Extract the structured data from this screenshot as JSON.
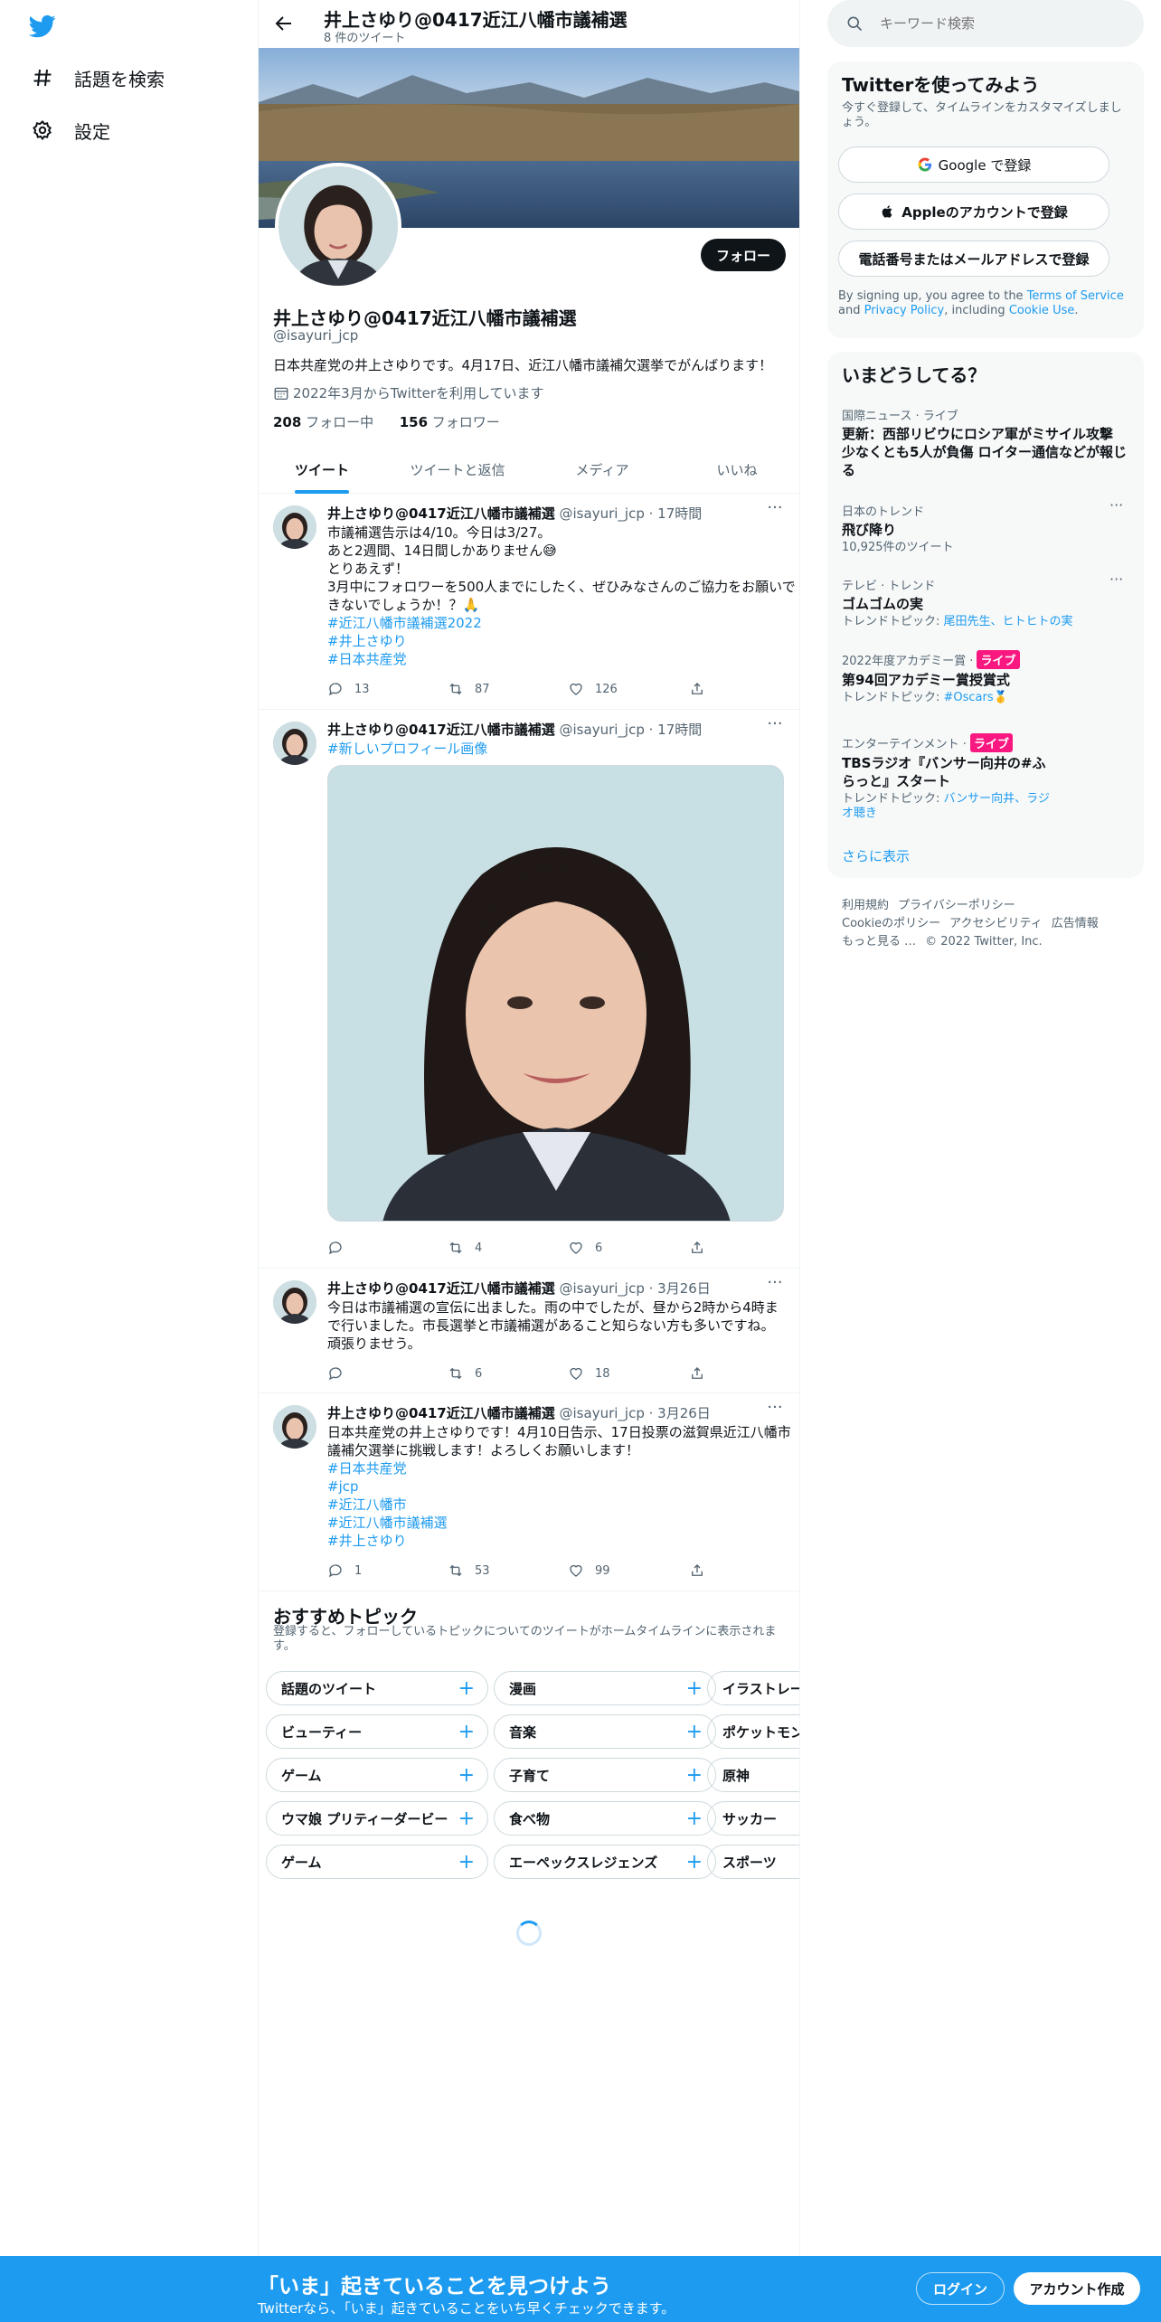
{
  "nav": {
    "items": [
      {
        "label": "話題を検索",
        "icon": "hashtag-icon"
      },
      {
        "label": "設定",
        "icon": "gear-icon"
      }
    ]
  },
  "header": {
    "title": "井上さゆり@0417近江八幡市議補選",
    "subtitle": "8 件のツイート"
  },
  "profile": {
    "name": "井上さゆり@0417近江八幡市議補選",
    "handle": "@isayuri_jcp",
    "bio": "日本共産党の井上さゆりです。4月17日、近江八幡市議補欠選挙でがんばります！",
    "joined": "2022年3月からTwitterを利用しています",
    "following_count": "208",
    "following_label": " フォロー中",
    "followers_count": "156",
    "followers_label": " フォロワー",
    "follow_button": "フォロー"
  },
  "tabs": [
    "ツイート",
    "ツイートと返信",
    "メディア",
    "いいね"
  ],
  "tweets": [
    {
      "name": "井上さゆり@0417近江八幡市議補選",
      "meta": " @isayuri_jcp · 17時間",
      "lines": [
        "市議補選告示は4/10。今日は3/27。",
        "あと2週間、14日間しかありません😅",
        "とりあえず！",
        "3月中にフォロワーを500人までにしたく、ぜひみなさんのご協力をお願いで",
        "きないでしょうか！？🙏"
      ],
      "tags": [
        "#近江八幡市議補選2022",
        "#井上さゆり",
        "#日本共産党"
      ],
      "replies": "13",
      "retweets": "87",
      "likes": "126"
    },
    {
      "name": "井上さゆり@0417近江八幡市議補選",
      "meta": " @isayuri_jcp · 17時間",
      "lines": [],
      "tags": [
        "#新しいプロフィール画像"
      ],
      "replies": "",
      "retweets": "4",
      "likes": "6"
    },
    {
      "name": "井上さゆり@0417近江八幡市議補選",
      "meta": " @isayuri_jcp · 3月26日",
      "lines": [
        "今日は市議補選の宣伝に出ました。雨の中でしたが、昼から2時から4時ま",
        "で行いました。市長選挙と市議補選があること知らない方も多いですね。",
        "頑張りませう。"
      ],
      "tags": [],
      "replies": "",
      "retweets": "6",
      "likes": "18"
    },
    {
      "name": "井上さゆり@0417近江八幡市議補選",
      "meta": " @isayuri_jcp · 3月26日",
      "lines": [
        "日本共産党の井上さゆりです！4月10日告示、17日投票の滋賀県近江八幡市",
        "議補欠選挙に挑戦します！よろしくお願いします！"
      ],
      "tags": [
        "#日本共産党",
        "#jcp",
        "#近江八幡市",
        "#近江八幡市議補選",
        "#井上さゆり"
      ],
      "replies": "1",
      "retweets": "53",
      "likes": "99"
    }
  ],
  "topics": {
    "title": "おすすめトピック",
    "subtitle": "登録すると、フォローしているトピックについてのツイートがホームタイムラインに表示されます。",
    "rows": [
      [
        "話題のツイート",
        "漫画",
        "イラストレーション"
      ],
      [
        "ビューティー",
        "音楽",
        "ポケットモンスター"
      ],
      [
        "ゲーム",
        "子育て",
        "原神"
      ],
      [
        "ウマ娘 プリティーダービー",
        "食べ物",
        "サッカー"
      ],
      [
        "ゲーム",
        "エーペックスレジェンズ",
        "スポーツ"
      ]
    ]
  },
  "search": {
    "placeholder": "キーワード検索"
  },
  "signup": {
    "title": "Twitterを使ってみよう",
    "desc": "今すぐ登録して、タイムラインをカスタマイズしましょう。",
    "google": "Google で登録",
    "apple": "Appleのアカウントで登録",
    "phone": "電話番号またはメールアドレスで登録",
    "terms_prefix": "By signing up, you agree to the ",
    "terms_link": "Terms of Service",
    "terms_and": " and ",
    "privacy_link": "Privacy Policy",
    "terms_incl": ", including ",
    "cookie_link": "Cookie Use",
    "terms_end": "."
  },
  "trends": {
    "title": "いまどうしてる？",
    "items": [
      {
        "context": "国際ニュース · ライブ",
        "title": "更新：西部リビウにロシア軍がミサイル攻撃 少なくとも5人が負傷 ロイター通信などが報じる",
        "sub": "",
        "sub_link": "",
        "live": ""
      },
      {
        "context": "日本のトレンド",
        "title": "飛び降り",
        "sub": "10,925件のツイート",
        "sub_link": "",
        "live": ""
      },
      {
        "context": "テレビ · トレンド",
        "title": "ゴムゴムの実",
        "sub": "トレンドトピック: ",
        "sub_link": "尾田先生、ヒトヒトの実",
        "live": ""
      },
      {
        "context": "2022年度アカデミー賞 · ",
        "title": "第94回アカデミー賞授賞式",
        "sub": "トレンドトピック: ",
        "sub_link": "#Oscars🥇",
        "live": "ライブ"
      },
      {
        "context": "エンターテインメント · ",
        "title": "TBSラジオ『バンサー向井の#ふらっと』スタート",
        "sub": "トレンドトピック: ",
        "sub_link": "バンサー向井、ラジオ聴き",
        "live": "ライブ"
      }
    ],
    "show_more": "さらに表示"
  },
  "footer": {
    "links": [
      "利用規約",
      "プライバシーポリシー",
      "Cookieのポリシー",
      "アクセシビリティ",
      "広告情報",
      "もっと見る …",
      "© 2022 Twitter, Inc."
    ]
  },
  "bottom": {
    "title": "「いま」起きていることを見つけよう",
    "subtitle": "Twitterなら、「いま」起きていることをいち早くチェックできます。",
    "login": "ログイン",
    "signup": "アカウント作成"
  },
  "colors": {
    "accent": "#1d9bf0",
    "live": "#f91880",
    "text": "#0f1419",
    "muted": "#536471"
  }
}
